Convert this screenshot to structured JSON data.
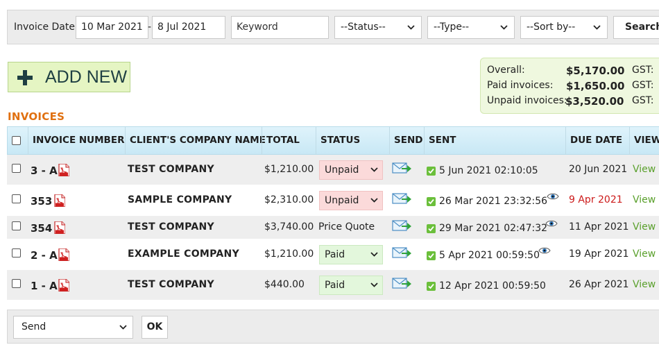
{
  "filters": {
    "date_label": "Invoice Date:",
    "date_from": "10 Mar 2021",
    "date_to": "8 Jul 2021",
    "keyword_placeholder": "Keyword",
    "status_select": "--Status--",
    "type_select": "--Type--",
    "sort_select": "--Sort by--",
    "search_label": "Search"
  },
  "add_new_label": "ADD NEW",
  "totals": {
    "overall_label": "Overall:",
    "overall_amount": "$5,170.00",
    "paid_label": "Paid invoices:",
    "paid_amount": "$1,650.00",
    "unpaid_label": "Unpaid invoices:",
    "unpaid_amount": "$3,520.00",
    "gst_label": "GST:"
  },
  "section_title": "INVOICES",
  "table": {
    "headers": {
      "invoice_number": "INVOICE NUMBER",
      "company": "CLIENT'S COMPANY NAME",
      "total": "TOTAL",
      "status": "STATUS",
      "send": "SEND",
      "sent": "SENT",
      "due": "DUE DATE",
      "view": "VIEW"
    },
    "rows": [
      {
        "number": "3 - A",
        "company": "TEST COMPANY",
        "total": "$1,210.00",
        "status": "Unpaid",
        "sent": "5 Jun 2021 02:10:05",
        "due": "20 Jun 2021",
        "view": "View"
      },
      {
        "number": "353",
        "company": "SAMPLE COMPANY",
        "total": "$2,310.00",
        "status": "Unpaid",
        "sent": "26 Mar 2021 23:32:56",
        "due": "9 Apr 2021",
        "view": "View"
      },
      {
        "number": "354",
        "company": "TEST COMPANY",
        "total": "$3,740.00",
        "status": "Price Quote",
        "sent": "29 Mar 2021 02:47:32",
        "due": "11 Apr 2021",
        "view": "View"
      },
      {
        "number": "2 - A",
        "company": "EXAMPLE COMPANY",
        "total": "$1,210.00",
        "status": "Paid",
        "sent": "5 Apr 2021 00:59:50",
        "due": "19 Apr 2021",
        "view": "View"
      },
      {
        "number": "1 - A",
        "company": "TEST COMPANY",
        "total": "$440.00",
        "status": "Paid",
        "sent": "12 Apr 2021 00:59:50",
        "due": "26 Apr 2021",
        "view": "View"
      }
    ]
  },
  "bulk_action": {
    "select_value": "Send",
    "ok_label": "OK"
  },
  "colors": {
    "accent_orange": "#e07010",
    "unpaid_bg": "#fbdada",
    "paid_bg": "#e3f7dc",
    "overdue_red": "#cc1a1a",
    "view_green": "#5aa02c"
  },
  "icons": {
    "add": "plus-icon",
    "pdf": "pdf-icon",
    "send": "send-mail-icon",
    "sent": "check-icon",
    "viewed": "eye-icon",
    "dropdown": "chevron-down-icon"
  }
}
